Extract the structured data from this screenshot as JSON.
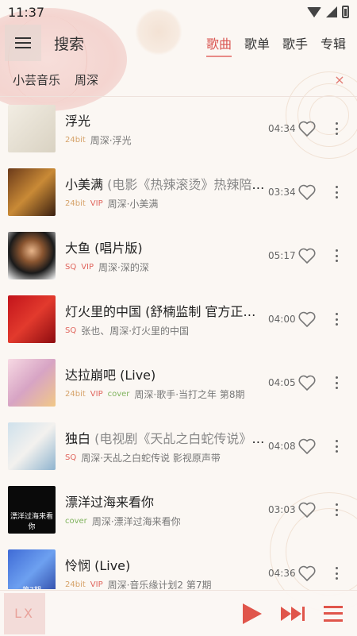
{
  "status": {
    "time": "11:37"
  },
  "header": {
    "title": "搜索",
    "tabs": [
      {
        "label": "歌曲",
        "active": true
      },
      {
        "label": "歌单",
        "active": false
      },
      {
        "label": "歌手",
        "active": false
      },
      {
        "label": "专辑",
        "active": false
      }
    ]
  },
  "search": {
    "source": "小芸音乐",
    "query": "周深",
    "clear_icon": "×"
  },
  "songs": [
    {
      "title": "浮光",
      "sub": "",
      "tags": [
        "24bit"
      ],
      "meta": "周深·浮光",
      "duration": "04:34",
      "cover_bg": "linear-gradient(135deg,#f2ede3,#d9d2c2)",
      "cover_text": ""
    },
    {
      "title": "小美满",
      "sub": " (电影《热辣滚烫》热辣陪伴曲)",
      "tags": [
        "24bit",
        "VIP"
      ],
      "meta": "周深·小美满",
      "duration": "03:34",
      "cover_bg": "linear-gradient(135deg,#6b3a1a,#c98a36,#3a1f10)",
      "cover_text": ""
    },
    {
      "title": "大鱼 (唱片版)",
      "sub": "",
      "tags": [
        "SQ",
        "VIP"
      ],
      "meta": "周深·深的深",
      "duration": "05:17",
      "cover_bg": "radial-gradient(circle at 50% 40%,#e8b58a 0%,#8a5530 30%,#1a1a1a 60%,#ffffff 100%)",
      "cover_text": ""
    },
    {
      "title": "灯火里的中国 (舒楠监制 官方正式版)",
      "sub": "",
      "tags": [
        "SQ"
      ],
      "meta": "张也、周深·灯火里的中国",
      "duration": "04:00",
      "cover_bg": "linear-gradient(135deg,#c2141b,#e23a2d,#8d0c10)",
      "cover_text": ""
    },
    {
      "title": "达拉崩吧 (Live)",
      "sub": "",
      "tags": [
        "24bit",
        "VIP",
        "cover"
      ],
      "meta": "周深·歌手·当打之年 第8期",
      "duration": "04:05",
      "cover_bg": "linear-gradient(135deg,#f7d9e3,#d7a4c4,#f1c887)",
      "cover_text": ""
    },
    {
      "title": "独白",
      "sub": " (电视剧《天乩之白蛇传说》插曲)",
      "tags": [
        "SQ"
      ],
      "meta": "周深·天乩之白蛇传说 影视原声带",
      "duration": "04:08",
      "cover_bg": "linear-gradient(135deg,#cfe1ec,#f3f1ee,#8fb4cf)",
      "cover_text": ""
    },
    {
      "title": "漂洋过海来看你",
      "sub": "",
      "tags": [
        "cover"
      ],
      "meta": "周深·漂洋过海来看你",
      "duration": "03:03",
      "cover_bg": "#0a0a0a",
      "cover_text": "漂洋过海来看你"
    },
    {
      "title": "怜悯 (Live)",
      "sub": "",
      "tags": [
        "24bit",
        "VIP"
      ],
      "meta": "周深·音乐缘计划2 第7期",
      "duration": "04:36",
      "cover_bg": "linear-gradient(135deg,#3f6bd6,#6da0f0,#2b45a3)",
      "cover_text": "第7期"
    }
  ],
  "player": {
    "cover_label": "LX"
  }
}
